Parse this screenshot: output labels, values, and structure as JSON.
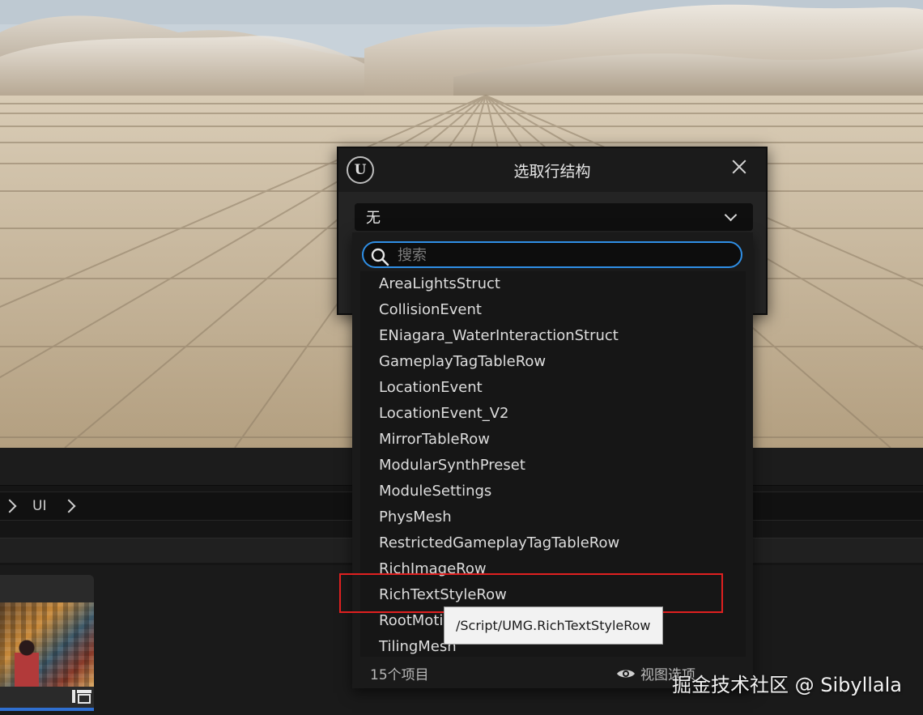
{
  "dialog": {
    "title": "选取行结构",
    "selected": "无",
    "logo_text": "U"
  },
  "search": {
    "placeholder": "搜索",
    "value": ""
  },
  "struct_list": [
    "AreaLightsStruct",
    "CollisionEvent",
    "ENiagara_WaterInteractionStruct",
    "GameplayTagTableRow",
    "LocationEvent",
    "LocationEvent_V2",
    "MirrorTableRow",
    "ModularSynthPreset",
    "ModuleSettings",
    "PhysMesh",
    "RestrictedGameplayTagTableRow",
    "RichImageRow",
    "RichTextStyleRow",
    "RootMotionSourceTableRow",
    "TilingMesh"
  ],
  "hovered_item": "RichTextStyleRow",
  "tooltip": "/Script/UMG.RichTextStyleRow",
  "footer": {
    "item_count": "15个项目",
    "view_options": "视图选项"
  },
  "path_bar": {
    "folder": "UI"
  },
  "watermark": "掘金技术社区 @ Sibyllala",
  "icons": {
    "search": "search-icon",
    "close": "close-icon",
    "eye": "eye-icon",
    "chevron": "chevron-down-icon"
  },
  "colors": {
    "accent": "#2f8fe6",
    "highlight": "#e02020"
  }
}
